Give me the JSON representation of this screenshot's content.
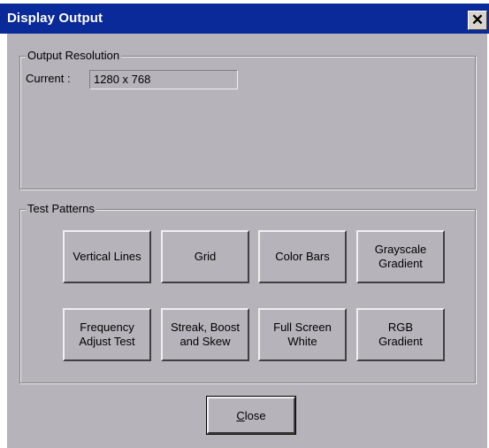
{
  "window": {
    "title": "Display Output",
    "close_glyph": "✕"
  },
  "output_resolution": {
    "group_label": "Output Resolution",
    "current_label": "Current :",
    "current_value": "1280 x 768"
  },
  "test_patterns": {
    "group_label": "Test Patterns",
    "buttons": [
      "Vertical Lines",
      "Grid",
      "Color Bars",
      "Grayscale\nGradient",
      "Frequency\nAdjust Test",
      "Streak, Boost\nand Skew",
      "Full Screen\nWhite",
      "RGB\nGradient"
    ]
  },
  "footer": {
    "close_accel": "C",
    "close_rest": "lose"
  },
  "colors": {
    "titlebar": "#0a2a9a",
    "face": "#b6b3bb"
  }
}
